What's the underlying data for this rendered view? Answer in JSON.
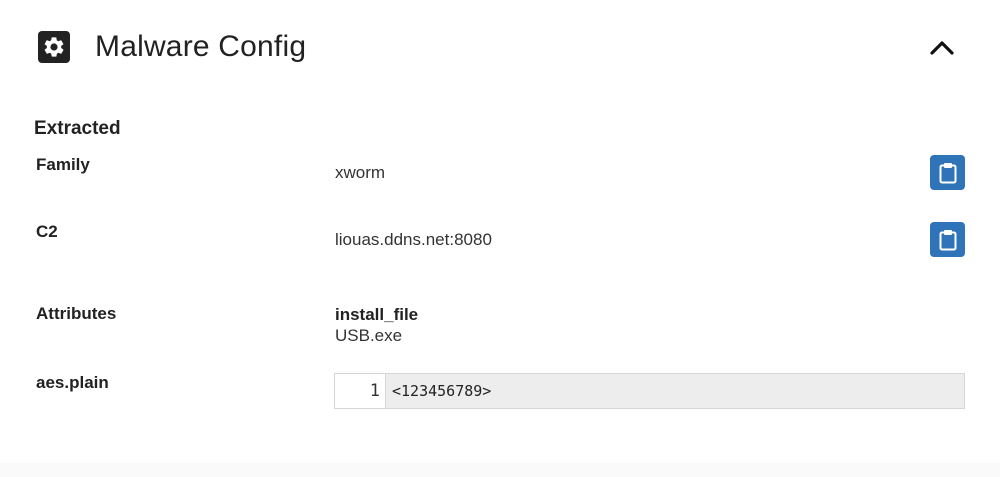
{
  "panel": {
    "title": "Malware Config",
    "icon": "gear-icon",
    "collapse_icon": "chevron-up-icon"
  },
  "extracted": {
    "heading": "Extracted",
    "family": {
      "label": "Family",
      "value": "xworm",
      "copy_icon": "clipboard-icon"
    },
    "c2": {
      "label": "C2",
      "value": "liouas.ddns.net:8080",
      "copy_icon": "clipboard-icon"
    },
    "attributes": {
      "label": "Attributes",
      "key": "install_file",
      "value": "USB.exe"
    },
    "aes_plain": {
      "label": "aes.plain",
      "line_number": "1",
      "code": "<123456789>"
    }
  },
  "colors": {
    "accent": "#2f73b8",
    "text": "#222222",
    "code_bg": "#ededed"
  }
}
